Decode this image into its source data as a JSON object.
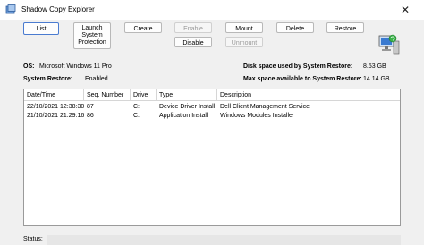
{
  "window": {
    "title": "Shadow Copy Explorer"
  },
  "toolbar": {
    "list": "List",
    "launch_1": "Launch",
    "launch_2": "System",
    "launch_3": "Protection",
    "create": "Create",
    "enable": "Enable",
    "disable": "Disable",
    "mount": "Mount",
    "unmount": "Unmount",
    "delete": "Delete",
    "restore": "Restore"
  },
  "info": {
    "os_label": "OS:",
    "os_value": "Microsoft Windows 11 Pro",
    "sr_label": "System Restore:",
    "sr_value": "Enabled",
    "disk_used_label": "Disk space used by System Restore:",
    "disk_used_value": "8.53 GB",
    "max_space_label": "Max space available to System Restore:",
    "max_space_value": "14.14 GB"
  },
  "table": {
    "columns": [
      "Date/Time",
      "Seq. Number",
      "Drive",
      "Type",
      "Description"
    ],
    "rows": [
      [
        "22/10/2021 12:38:30",
        "87",
        "C:",
        "Device Driver Install",
        "Dell Client Management Service"
      ],
      [
        "21/10/2021 21:29:16",
        "86",
        "C:",
        "Application Install",
        "Windows Modules Installer"
      ]
    ]
  },
  "status": {
    "label": "Status:"
  },
  "icons": {
    "app": "shadow-copy-app-icon",
    "close": "close-icon",
    "computer": "computer-restore-icon"
  },
  "colors": {
    "primary_button_border": "#4a7bd0",
    "window_bg": "#f0f0f0"
  }
}
